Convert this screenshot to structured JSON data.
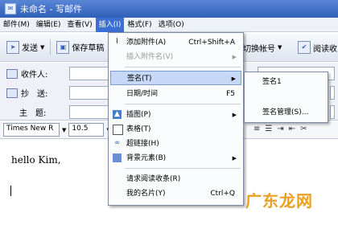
{
  "window": {
    "title": "未命名 - 写邮件"
  },
  "menubar": [
    "邮件(M)",
    "编辑(E)",
    "查看(V)",
    "插入(I)",
    "格式(F)",
    "选项(O)"
  ],
  "toolbar": {
    "send": "发送",
    "save_draft": "保存草稿",
    "switch_account": "切换帐号",
    "read_receipt": "阅读收"
  },
  "fields": {
    "to_label": "收件人:",
    "cc_label": "抄　送:",
    "subject_label": "主　题:"
  },
  "format": {
    "font": "Times New R",
    "size": "10.5"
  },
  "body": {
    "text": "hello Kim,"
  },
  "insert_menu": {
    "attach": {
      "label": "添加附件(A)",
      "shortcut": "Ctrl+Shift+A"
    },
    "insert_attach_name": {
      "label": "插入附件名(V)"
    },
    "signature": {
      "label": "签名(T)"
    },
    "datetime": {
      "label": "日期/时间",
      "shortcut": "F5"
    },
    "image": {
      "label": "插图(P)"
    },
    "table": {
      "label": "表格(T)"
    },
    "hyperlink": {
      "label": "超链接(H)"
    },
    "background": {
      "label": "背景元素(B)"
    },
    "read_receipt": {
      "label": "请求阅读收条(R)"
    },
    "business_card": {
      "label": "我的名片(Y)",
      "shortcut": "Ctrl+Q"
    }
  },
  "signature_submenu": {
    "item1": "签名1",
    "manage": "签名管理(S)..."
  },
  "watermark": "广东龙网",
  "colors": {
    "title_bar": "#3a6cc8",
    "menu_highlight": "#3c6fd1",
    "item_highlight": "#c6d8f5",
    "watermark": "#e8a020"
  }
}
